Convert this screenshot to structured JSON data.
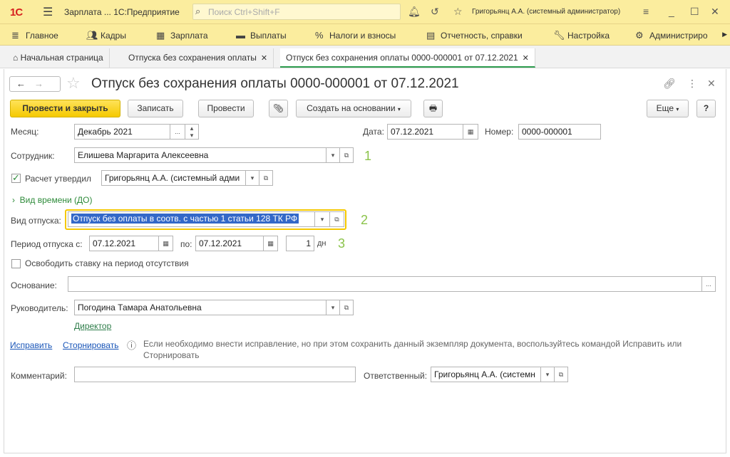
{
  "titlebar": {
    "logo": "1С",
    "app_title": "Зарплата ...  1С:Предприятие",
    "search_placeholder": "Поиск Ctrl+Shift+F",
    "user": "Григорьянц А.А. (системный администратор)"
  },
  "sections": [
    {
      "label": "Главное",
      "icon": "menu-icon"
    },
    {
      "label": "Кадры",
      "icon": "people-icon"
    },
    {
      "label": "Зарплата",
      "icon": "calculator-icon"
    },
    {
      "label": "Выплаты",
      "icon": "wallet-icon"
    },
    {
      "label": "Налоги и взносы",
      "icon": "percent-icon"
    },
    {
      "label": "Отчетность, справки",
      "icon": "report-icon"
    },
    {
      "label": "Настройка",
      "icon": "wrench-icon"
    },
    {
      "label": "Администриро",
      "icon": "gear-icon"
    }
  ],
  "tabs": [
    {
      "label": "Начальная страница"
    },
    {
      "label": "Отпуска без сохранения оплаты"
    },
    {
      "label": "Отпуск без сохранения оплаты 0000-000001 от 07.12.2021"
    }
  ],
  "doc": {
    "title": "Отпуск без сохранения оплаты 0000-000001 от 07.12.2021"
  },
  "toolbar": {
    "post_close": "Провести и закрыть",
    "save": "Записать",
    "post": "Провести",
    "create_based": "Создать на основании",
    "more": "Еще",
    "help": "?"
  },
  "form": {
    "month_label": "Месяц:",
    "month_value": "Декабрь 2021",
    "date_label": "Дата:",
    "date_value": "07.12.2021",
    "number_label": "Номер:",
    "number_value": "0000-000001",
    "employee_label": "Сотрудник:",
    "employee_value": "Елишева Маргарита Алексеевна",
    "approved_label": "Расчет утвердил",
    "approved_value": "Григорьянц А.А. (системный адми",
    "time_type_link": "Вид времени (ДО)",
    "leave_type_label": "Вид отпуска:",
    "leave_type_value": "Отпуск без оплаты в соотв. с частью 1 статьи 128 ТК РФ",
    "period_label": "Период отпуска с:",
    "period_from": "07.12.2021",
    "period_to_label": "по:",
    "period_to": "07.12.2021",
    "days_value": "1",
    "days_unit": "дн",
    "release_rate_label": "Освободить ставку на период отсутствия",
    "basis_label": "Основание:",
    "basis_value": "",
    "manager_label": "Руководитель:",
    "manager_value": "Погодина Тамара Анатольевна",
    "manager_position": "Директор",
    "fix_link": "Исправить",
    "storno_link": "Сторнировать",
    "info_line1": "Если необходимо внести исправление, но при этом сохранить данный экземпляр документа, воспользуйтесь командой Исправить или",
    "info_line2": "Сторнировать",
    "comment_label": "Комментарий:",
    "comment_value": "",
    "responsible_label": "Ответственный:",
    "responsible_value": "Григорьянц А.А. (системн"
  },
  "annotations": [
    "1",
    "2",
    "3"
  ]
}
